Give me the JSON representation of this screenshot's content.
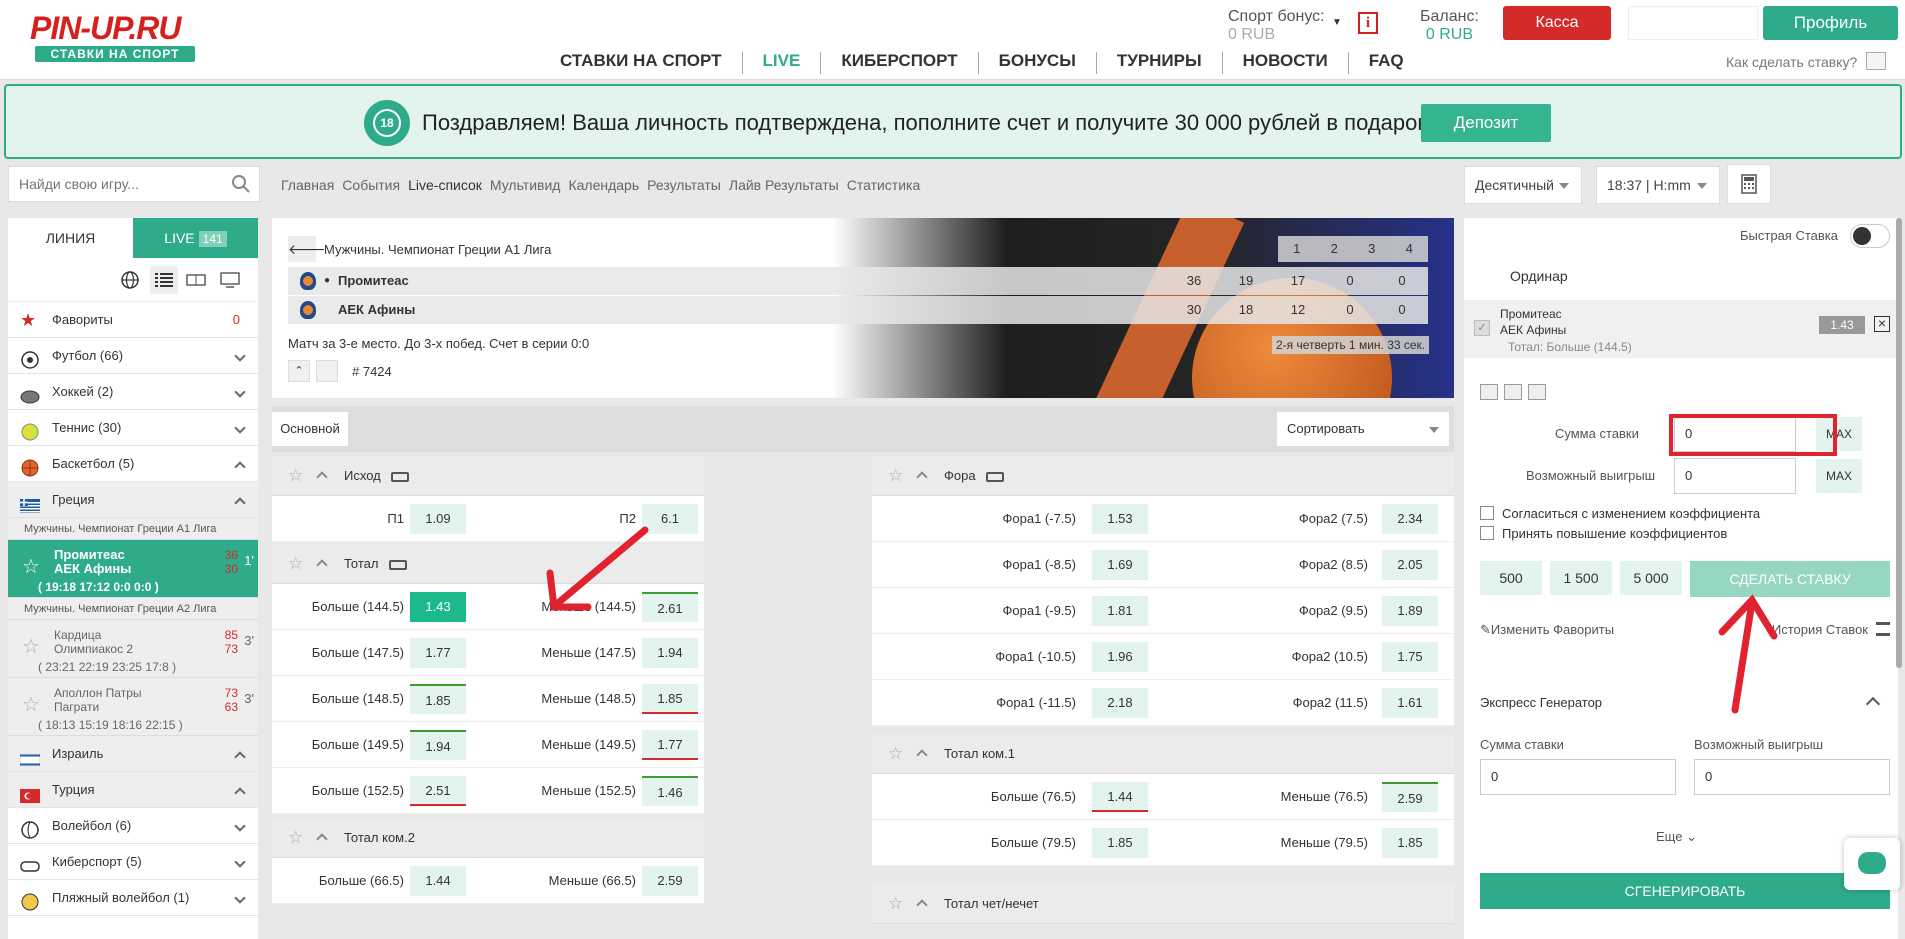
{
  "brand": {
    "logo_text": "PIN-UP.RU",
    "logo_sub": "СТАВКИ НА СПОРТ"
  },
  "header": {
    "bonus_label": "Спорт бонус:",
    "bonus_value": "0 RUB",
    "balance_label": "Баланс:",
    "balance_value": "0 RUB",
    "kassa": "Касса",
    "profile": "Профиль",
    "how_to": "Как сделать ставку?"
  },
  "mainnav": [
    "СТАВКИ НА СПОРТ",
    "LIVE",
    "КИБЕРСПОРТ",
    "БОНУСЫ",
    "ТУРНИРЫ",
    "НОВОСТИ",
    "FAQ"
  ],
  "banner": {
    "age": "18",
    "text": "Поздравляем! Ваша личность подтверждена, пополните счет и получите 30 000 рублей в подарок!",
    "button": "Депозит"
  },
  "search": {
    "placeholder": "Найди свою игру..."
  },
  "subnav": [
    "Главная",
    "События",
    "Live-список",
    "Мультивид",
    "Календарь",
    "Результаты",
    "Лайв Результаты",
    "Статистика"
  ],
  "format_select": "Десятичный",
  "time_select": "18:37 | H:mm",
  "sidebar": {
    "tab_line": "ЛИНИЯ",
    "tab_live": "LIVE",
    "live_count": "141",
    "sports": [
      {
        "name": "Фавориты",
        "count": "0",
        "icon": "star-icon"
      },
      {
        "name": "Футбол (66)",
        "icon": "football-icon"
      },
      {
        "name": "Хоккей (2)",
        "icon": "hockey-icon"
      },
      {
        "name": "Теннис (30)",
        "icon": "tennis-icon"
      },
      {
        "name": "Баскетбол (5)",
        "icon": "basketball-icon"
      },
      {
        "name": "Греция",
        "icon": "greece-flag-icon"
      }
    ],
    "league1": "Мужчины. Чемпионат Греции А1 Лига",
    "active_match": {
      "team1": "Промитеас",
      "team2": "АЕК Афины",
      "score1": "36",
      "score2": "30",
      "minute": "1'",
      "periods": "( 19:18  17:12  0:0  0:0 )"
    },
    "league2": "Мужчины. Чемпионат Греции А2 Лига",
    "match2": {
      "team1": "Кардица",
      "team2": "Олимпиакос 2",
      "score1": "85",
      "score2": "73",
      "minute": "3'",
      "periods": "( 23:21  22:19  23:25  17:8 )"
    },
    "match3": {
      "team1": "Аполлон Патры",
      "team2": "Пагрaти",
      "score1": "73",
      "score2": "63",
      "minute": "3'",
      "periods": "( 18:13  15:19  18:16  22:15 )"
    },
    "more": [
      {
        "name": "Израиль",
        "icon": "israel-flag-icon"
      },
      {
        "name": "Турция",
        "icon": "turkey-flag-icon"
      },
      {
        "name": "Волейбол (6)",
        "icon": "volleyball-icon"
      },
      {
        "name": "Киберспорт (5)",
        "icon": "esports-icon"
      },
      {
        "name": "Пляжный волейбол (1)",
        "icon": "beach-volleyball-icon"
      }
    ]
  },
  "event": {
    "league": "Мужчины. Чемпионат Греции А1 Лига",
    "quarters": [
      "1",
      "2",
      "3",
      "4"
    ],
    "team1": {
      "name": "Промитеас",
      "total": "36",
      "q": [
        "19",
        "17",
        "0",
        "0"
      ]
    },
    "team2": {
      "name": "АЕК Афины",
      "total": "30",
      "q": [
        "18",
        "12",
        "0",
        "0"
      ]
    },
    "description": "Матч за 3-е место. До 3-х побед. Счет в серии 0:0",
    "status": "2-я четверть  1 мин. 33 сек.",
    "event_id": "# 7424"
  },
  "filter": {
    "tab": "Основной",
    "sort": "Сортировать"
  },
  "markets": {
    "outcome": {
      "title": "Исход",
      "rows": [
        {
          "l1": "П1",
          "o1": "1.09",
          "l2": "П2",
          "o2": "6.1"
        }
      ]
    },
    "total": {
      "title": "Тотал",
      "rows": [
        {
          "l1": "Больше (144.5)",
          "o1": "1.43",
          "l2": "Меньше (144.5)",
          "o2": "2.61"
        },
        {
          "l1": "Больше (147.5)",
          "o1": "1.77",
          "l2": "Меньше (147.5)",
          "o2": "1.94"
        },
        {
          "l1": "Больше (148.5)",
          "o1": "1.85",
          "l2": "Меньше (148.5)",
          "o2": "1.85"
        },
        {
          "l1": "Больше (149.5)",
          "o1": "1.94",
          "l2": "Меньше (149.5)",
          "o2": "1.77"
        },
        {
          "l1": "Больше (152.5)",
          "o1": "2.51",
          "l2": "Меньше (152.5)",
          "o2": "1.46"
        }
      ]
    },
    "total2": {
      "title": "Тотал ком.2",
      "rows": [
        {
          "l1": "Больше (66.5)",
          "o1": "1.44",
          "l2": "Меньше (66.5)",
          "o2": "2.59"
        }
      ]
    },
    "fora": {
      "title": "Фора",
      "rows": [
        {
          "l1": "Фора1 (-7.5)",
          "o1": "1.53",
          "l2": "Фора2 (7.5)",
          "o2": "2.34"
        },
        {
          "l1": "Фора1 (-8.5)",
          "o1": "1.69",
          "l2": "Фора2 (8.5)",
          "o2": "2.05"
        },
        {
          "l1": "Фора1 (-9.5)",
          "o1": "1.81",
          "l2": "Фора2 (9.5)",
          "o2": "1.89"
        },
        {
          "l1": "Фора1 (-10.5)",
          "o1": "1.96",
          "l2": "Фора2 (10.5)",
          "o2": "1.75"
        },
        {
          "l1": "Фора1 (-11.5)",
          "o1": "2.18",
          "l2": "Фора2 (11.5)",
          "o2": "1.61"
        }
      ]
    },
    "total1": {
      "title": "Тотал ком.1",
      "rows": [
        {
          "l1": "Больше (76.5)",
          "o1": "1.44",
          "l2": "Меньше (76.5)",
          "o2": "2.59"
        },
        {
          "l1": "Больше (79.5)",
          "o1": "1.85",
          "l2": "Меньше (79.5)",
          "o2": "1.85"
        }
      ]
    },
    "evenodd": {
      "title": "Тотал чет/нечет"
    }
  },
  "slip": {
    "quick": "Быстрая Ставка",
    "ordinar": "Ординар",
    "team1": "Промитеас",
    "team2": "АЕК Афины",
    "bet": "Тотал: Больше (144.5)",
    "odd": "1.43",
    "stake_label": "Сумма ставки",
    "stake_value": "0",
    "win_label": "Возможный выигрыш",
    "win_value": "0",
    "max": "MAX",
    "agree": "Согласиться с изменением коэффициента",
    "accept": "Принять повышение коэффициентов",
    "quick_amounts": [
      "500",
      "1 500",
      "5 000"
    ],
    "make_bet": "СДЕЛАТЬ СТАВКУ",
    "edit_fav": "Изменить Фавориты",
    "history": "История Ставок"
  },
  "express": {
    "title": "Экспресс Генератор",
    "stake_label": "Сумма ставки",
    "win_label": "Возможный выигрыш",
    "stake_value": "0",
    "win_value": "0",
    "more": "Еще",
    "generate": "СГЕНЕРИРОВАТЬ"
  },
  "colors": {
    "accent": "#2eab8a",
    "red": "#d42a2a",
    "odd_bg": "#e3f4ee"
  }
}
